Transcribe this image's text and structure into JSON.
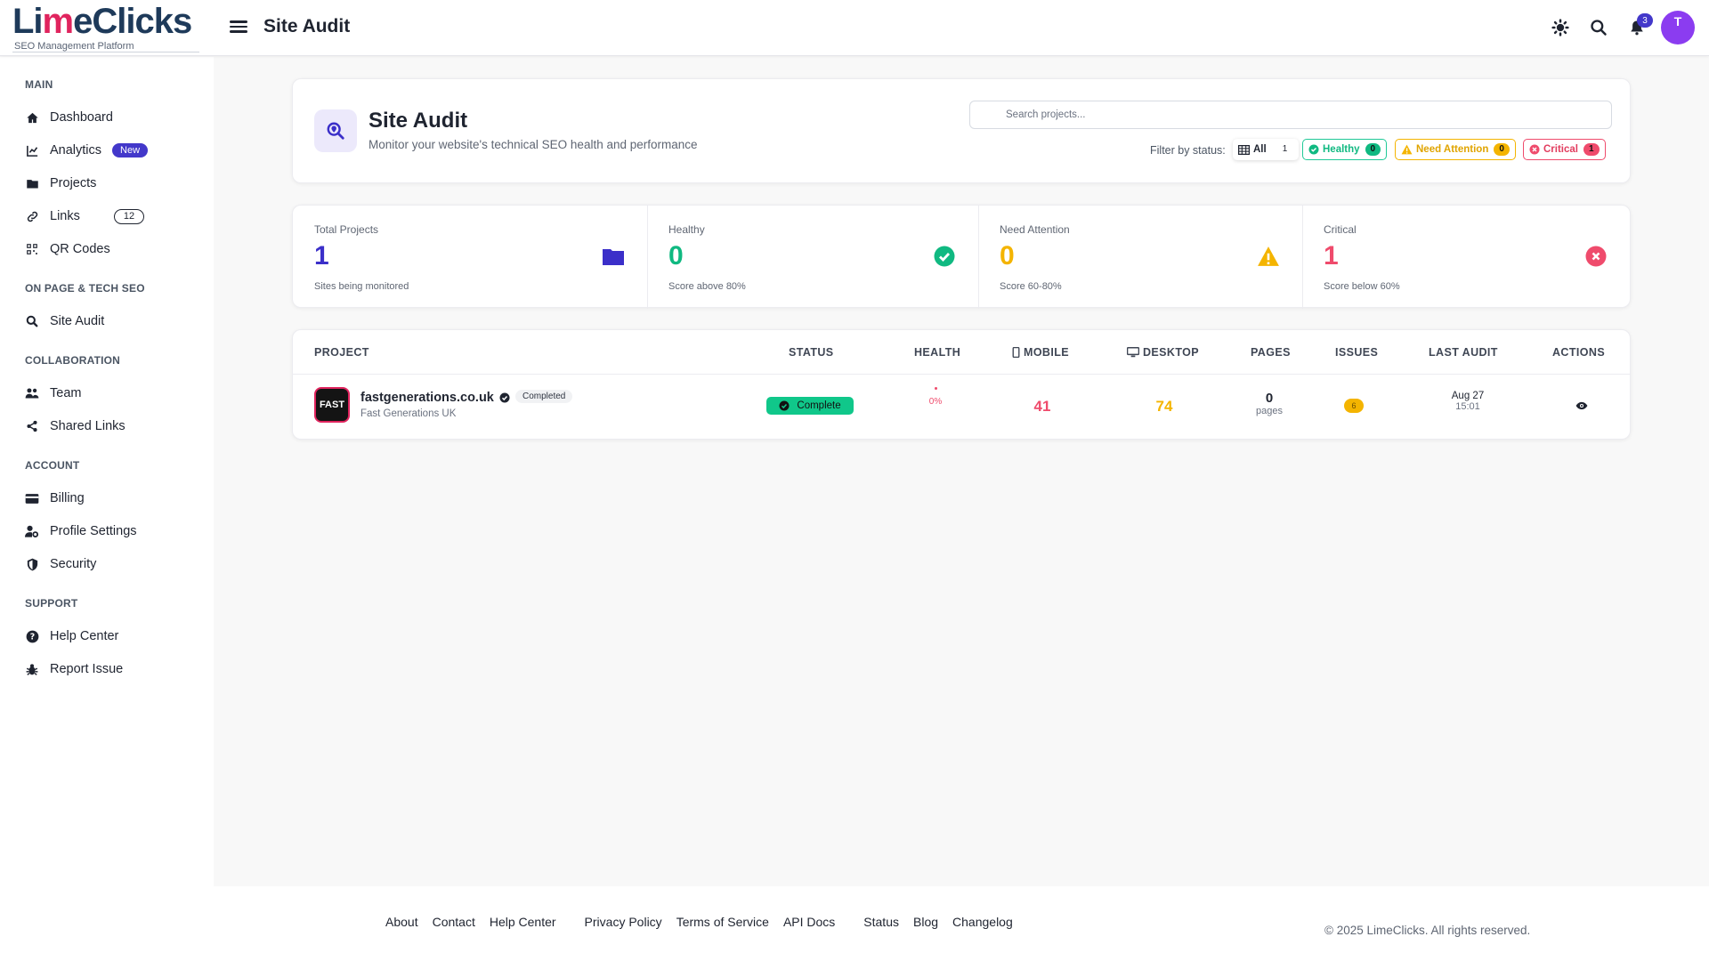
{
  "header": {
    "logo": {
      "pre": "Li",
      "accent": "m",
      "post": "eClicks",
      "subtitle": "SEO Management Platform"
    },
    "title": "Site Audit",
    "notifications_count": "3",
    "avatar_initial": "T"
  },
  "sidebar": {
    "sections": [
      {
        "label": "MAIN"
      },
      {
        "label": "ON PAGE & TECH SEO"
      },
      {
        "label": "COLLABORATION"
      },
      {
        "label": "ACCOUNT"
      },
      {
        "label": "SUPPORT"
      }
    ],
    "items": [
      {
        "label": "Dashboard",
        "icon": "home-icon"
      },
      {
        "label": "Analytics",
        "icon": "chart-icon",
        "badge": "New"
      },
      {
        "label": "Projects",
        "icon": "folder-icon"
      },
      {
        "label": "Links",
        "icon": "link-icon",
        "count": "12"
      },
      {
        "label": "QR Codes",
        "icon": "qr-icon"
      },
      {
        "label": "Site Audit",
        "icon": "search-icon"
      },
      {
        "label": "Team",
        "icon": "users-icon"
      },
      {
        "label": "Shared Links",
        "icon": "share-icon"
      },
      {
        "label": "Billing",
        "icon": "credit-card-icon"
      },
      {
        "label": "Profile Settings",
        "icon": "user-cog-icon"
      },
      {
        "label": "Security",
        "icon": "shield-icon"
      },
      {
        "label": "Help Center",
        "icon": "help-icon"
      },
      {
        "label": "Report Issue",
        "icon": "bug-icon"
      }
    ]
  },
  "page": {
    "title": "Site Audit",
    "subtitle": "Monitor your website's technical SEO health and performance",
    "search_placeholder": "Search projects...",
    "filter_label": "Filter by status:",
    "filters": [
      {
        "label": "All",
        "count": "1"
      },
      {
        "label": "Healthy",
        "count": "0"
      },
      {
        "label": "Need Attention",
        "count": "0"
      },
      {
        "label": "Critical",
        "count": "1"
      }
    ]
  },
  "stats": [
    {
      "label": "Total Projects",
      "value": "1",
      "note": "Sites being monitored",
      "color": "#3b2fc9"
    },
    {
      "label": "Healthy",
      "value": "0",
      "note": "Score above 80%",
      "color": "#10b981"
    },
    {
      "label": "Need Attention",
      "value": "0",
      "note": "Score 60-80%",
      "color": "#f4b400"
    },
    {
      "label": "Critical",
      "value": "1",
      "note": "Score below 60%",
      "color": "#ef4b6c"
    }
  ],
  "table": {
    "columns": [
      "PROJECT",
      "STATUS",
      "HEALTH",
      "MOBILE",
      "DESKTOP",
      "PAGES",
      "ISSUES",
      "LAST AUDIT",
      "ACTIONS"
    ],
    "rows": [
      {
        "logo_text": "FAST",
        "name": "fastgenerations.co.uk",
        "company": "Fast Generations UK",
        "state": "Completed",
        "status": "Complete",
        "health": "0%",
        "mobile": "41",
        "desktop": "74",
        "pages": "0",
        "pages_unit": "pages",
        "issues": "6",
        "audit_date": "Aug 27",
        "audit_time": "15:01"
      }
    ]
  },
  "footer": {
    "links": [
      "About",
      "Contact",
      "Help Center",
      "Privacy Policy",
      "Terms of Service",
      "API Docs",
      "Status",
      "Blog",
      "Changelog"
    ],
    "copyright": "© 2025 LimeClicks. All rights reserved."
  },
  "colors": {
    "primary": "#4338ca",
    "healthy": "#10b981",
    "attention": "#f4b400",
    "critical": "#ef4b6c"
  }
}
